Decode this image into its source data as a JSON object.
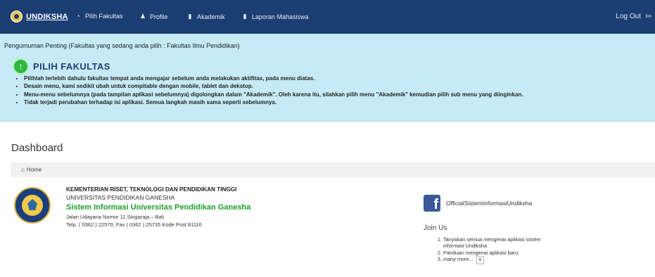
{
  "brand": {
    "name": "UNDIKSHA",
    "logo_icon": "undiksha-logo-icon"
  },
  "nav": {
    "items": [
      {
        "label": "Pilih Fakultas",
        "icon": "gauge-icon"
      },
      {
        "label": "Profile",
        "icon": "user-icon"
      },
      {
        "label": "Akademik",
        "icon": "book-icon"
      },
      {
        "label": "Laporan Mahasiswa",
        "icon": "book-icon"
      }
    ],
    "logout": {
      "label": "Log Out",
      "icon": "sign-out-icon"
    }
  },
  "announcement": {
    "title": "Pengumuman Penting (Fakultas yang sedang anda pilih : Fakultas Ilmu Pendidikan)",
    "heading": "PILIH FAKULTAS",
    "items": [
      "Pilihlah terlebih dahulu fakultas tempat anda mengajar sebelum anda melakukan aktifitas, pada menu diatas.",
      "Desain menu, kami sedikit ubah untuk compitable dengan mobile, tablet dan dekstop.",
      "Menu-menu sebelumnya (pada tampilan aplikasi sebelumnya) digolongkan dalam \"Akademik\". Oleh karena itu, silahkan pilih menu \"Akademik\" kemudian pilih sub menu yang diinginkan.",
      "Tidak terjadi perubahan terhadap isi aplikasi. Semua langkah masih sama seperti sebelumnya."
    ]
  },
  "page": {
    "title": "Dashboard"
  },
  "breadcrumb": {
    "home": "Home"
  },
  "institution": {
    "ministry": "KEMENTERIAN RISET, TEKNOLOGI DAN PENDIDIKAN TINGGI",
    "university": "UNIVERSITAS PENDIDIKAN GANESHA",
    "system": "Sistem Informasi Universitas Pendidikan Ganesha",
    "address": "Jalan Udayana Nomor 11 Singaraja – Bali",
    "phone": "Telp. ( 0362 ) 22570, Fax ( 0362 ) 25735 Kode Post 81116"
  },
  "social": {
    "facebook": "OfficialSistemInformasiUndiksha"
  },
  "join": {
    "title": "Join Us",
    "items": [
      "Tanyakan semua mengenai aplikasi sistem informasi Undiksha",
      "Panduan mengenai aplikasi baru.",
      "many more..."
    ],
    "close": "x"
  },
  "colors": {
    "navbar": "#1c3f73",
    "announcement_bg": "#c6ebf6",
    "accent_green": "#1e9e2a",
    "facebook": "#3b5998"
  }
}
